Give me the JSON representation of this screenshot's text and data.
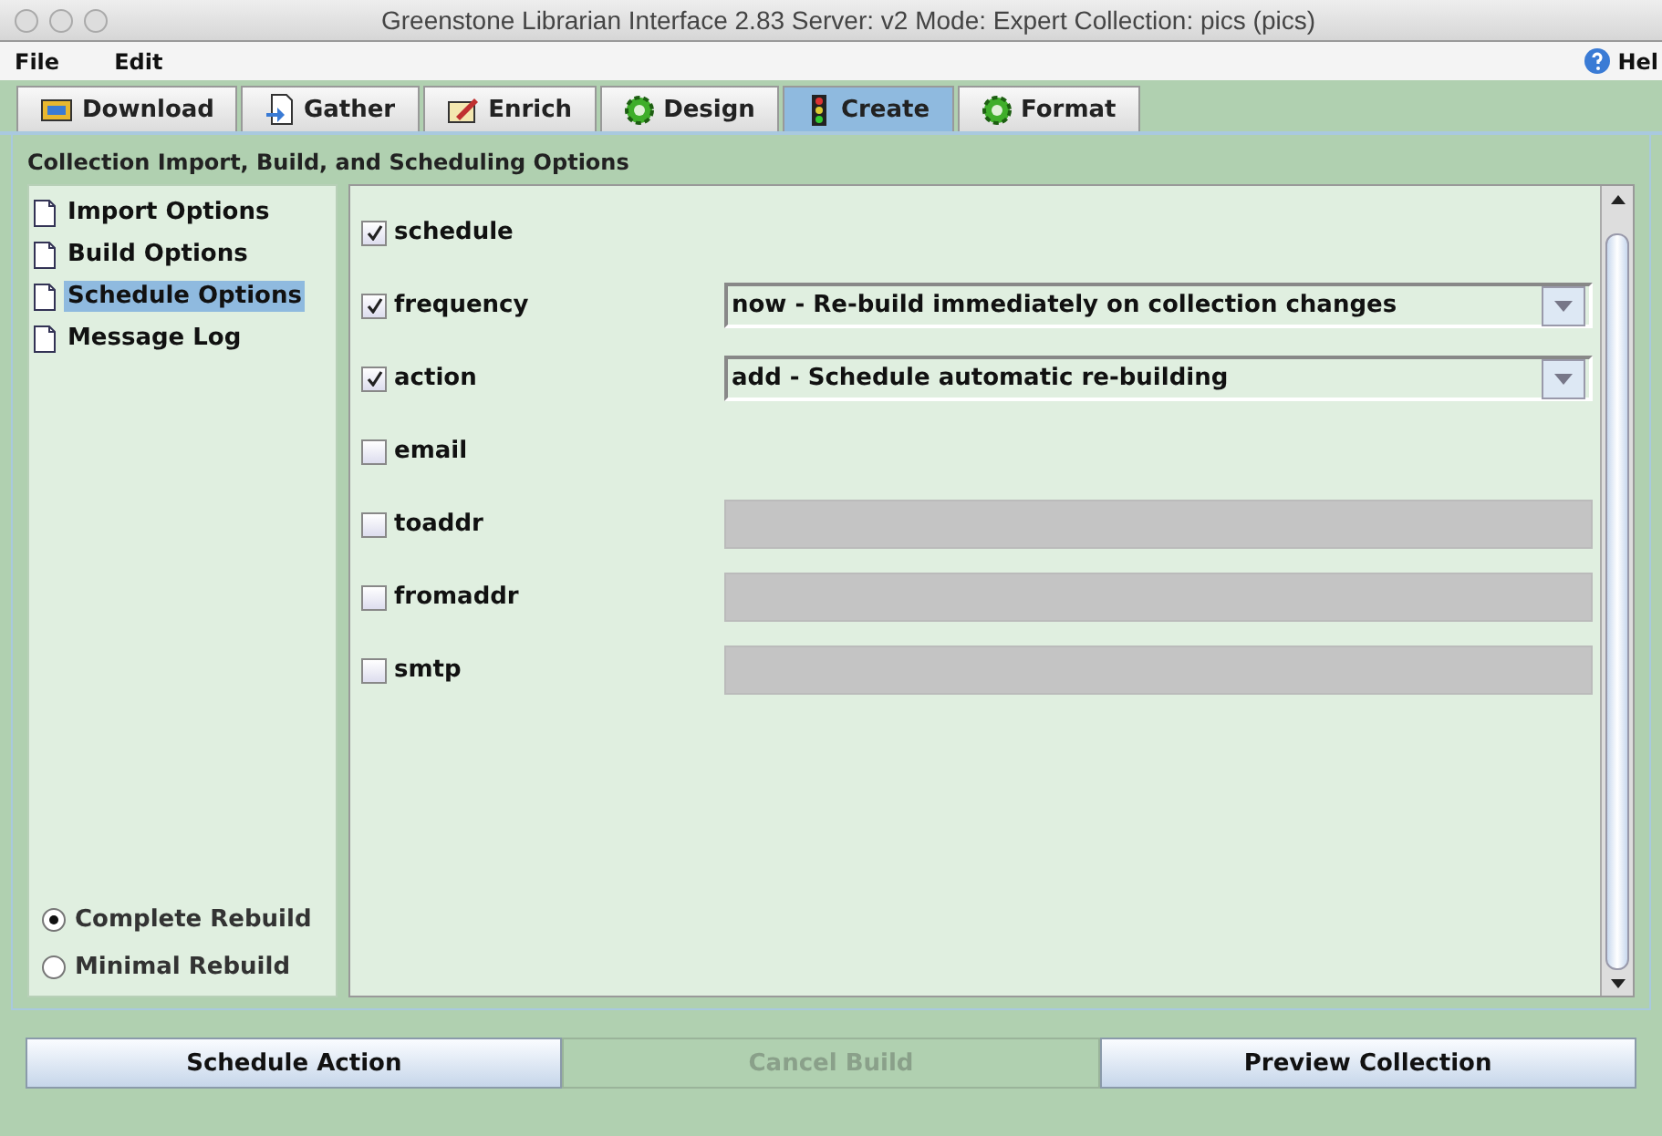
{
  "window": {
    "title": "Greenstone Librarian Interface 2.83  Server: v2  Mode: Expert  Collection: pics (pics)"
  },
  "menu": [
    "File",
    "Edit"
  ],
  "help": "Hel",
  "tabs": [
    {
      "label": "Download",
      "kind": "download",
      "selected": false
    },
    {
      "label": "Gather",
      "kind": "gather",
      "selected": false
    },
    {
      "label": "Enrich",
      "kind": "enrich",
      "selected": false
    },
    {
      "label": "Design",
      "kind": "gear",
      "selected": false
    },
    {
      "label": "Create",
      "kind": "create",
      "selected": true
    },
    {
      "label": "Format",
      "kind": "gear",
      "selected": false
    }
  ],
  "panel_title": "Collection Import, Build, and Scheduling Options",
  "sidebar": {
    "items": [
      {
        "label": "Import Options",
        "selected": false
      },
      {
        "label": "Build Options",
        "selected": false
      },
      {
        "label": "Schedule Options",
        "selected": true
      },
      {
        "label": "Message Log",
        "selected": false
      }
    ],
    "rebuild": [
      {
        "label": "Complete Rebuild",
        "selected": true
      },
      {
        "label": "Minimal Rebuild",
        "selected": false
      }
    ]
  },
  "options": [
    {
      "kind": "plain",
      "label": "schedule",
      "checked": true
    },
    {
      "kind": "combo",
      "label": "frequency",
      "checked": true,
      "value": "now - Re-build immediately on collection changes"
    },
    {
      "kind": "combo",
      "label": "action",
      "checked": true,
      "value": "add - Schedule automatic re-building"
    },
    {
      "kind": "plain",
      "label": "email",
      "checked": false
    },
    {
      "kind": "text",
      "label": "toaddr",
      "checked": false,
      "disabled": true
    },
    {
      "kind": "text",
      "label": "fromaddr",
      "checked": false,
      "disabled": true
    },
    {
      "kind": "text",
      "label": "smtp",
      "checked": false,
      "disabled": true
    }
  ],
  "buttons": [
    {
      "label": "Schedule Action",
      "disabled": false
    },
    {
      "label": "Cancel Build",
      "disabled": true
    },
    {
      "label": "Preview Collection",
      "disabled": false
    }
  ]
}
